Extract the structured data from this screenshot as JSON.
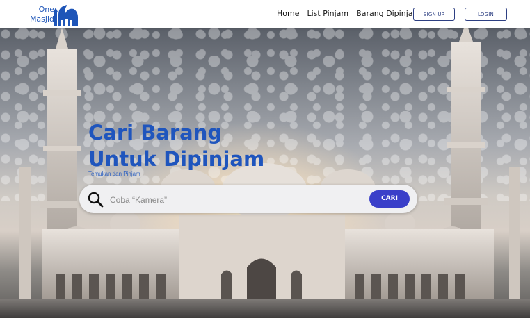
{
  "brand": {
    "line1": "One",
    "line2": "Masjid",
    "logo_icon": "mosque-icon"
  },
  "nav": {
    "items": [
      {
        "label": "Home"
      },
      {
        "label": "List Pinjam"
      },
      {
        "label": "Barang Dipinjam"
      }
    ],
    "signup_label": "SIGN UP",
    "login_label": "LOGIN"
  },
  "hero": {
    "title_line1": "Cari Barang",
    "title_line2": "Untuk Dipinjam",
    "subtitle": "Temukan dan Pinjam"
  },
  "search": {
    "placeholder": "Coba “Kamera”",
    "button_label": "CARI",
    "icon": "search-icon"
  },
  "colors": {
    "brand_blue": "#1e55b8",
    "button_blue": "#3a3fc9",
    "outline": "#2d3f82"
  }
}
